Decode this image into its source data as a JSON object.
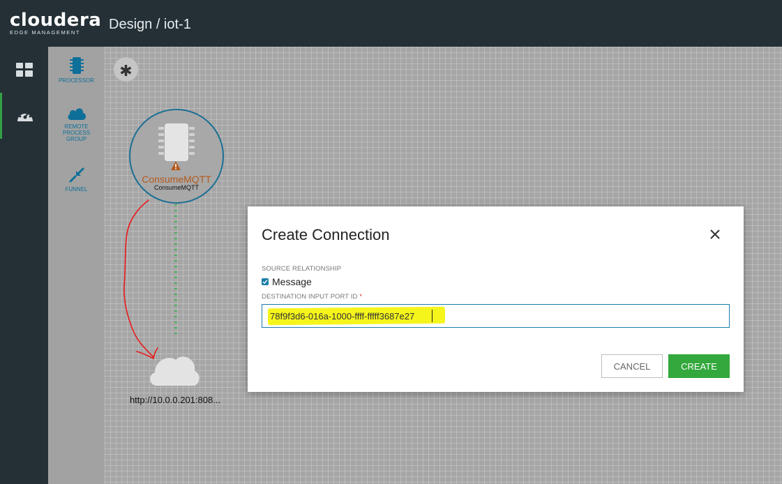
{
  "app": {
    "brand": "cloudera",
    "brand_sub": "EDGE MANAGEMENT",
    "title": "Design / iot-1"
  },
  "nav": {
    "items": [
      {
        "icon": "dashboard-icon"
      },
      {
        "icon": "speedometer-icon",
        "active": true
      }
    ]
  },
  "palette": {
    "items": [
      {
        "label": "PROCESSOR",
        "icon": "chip-icon"
      },
      {
        "label": "REMOTE PROCESS GROUP",
        "icon": "cloud-icon"
      },
      {
        "label": "FUNNEL",
        "icon": "funnel-icon"
      }
    ]
  },
  "canvas": {
    "processor": {
      "name": "ConsumeMQTT",
      "type": "ConsumeMQTT",
      "status_icon": "warning-icon"
    },
    "remote_process_group": {
      "url": "http://10.0.0.201:808..."
    }
  },
  "dialog": {
    "title": "Create Connection",
    "source_relationship_label": "SOURCE RELATIONSHIP",
    "relationship": {
      "label": "Message",
      "checked": true
    },
    "destination_label": "DESTINATION INPUT PORT ID",
    "required_marker": "*",
    "destination_value": "78f9f3d6-016a-1000-ffff-fffff3687e27",
    "cancel_label": "CANCEL",
    "create_label": "CREATE"
  },
  "colors": {
    "topbar": "#243036",
    "accent": "#33a83c",
    "link": "#1b7da8",
    "warning": "#b4591d"
  }
}
